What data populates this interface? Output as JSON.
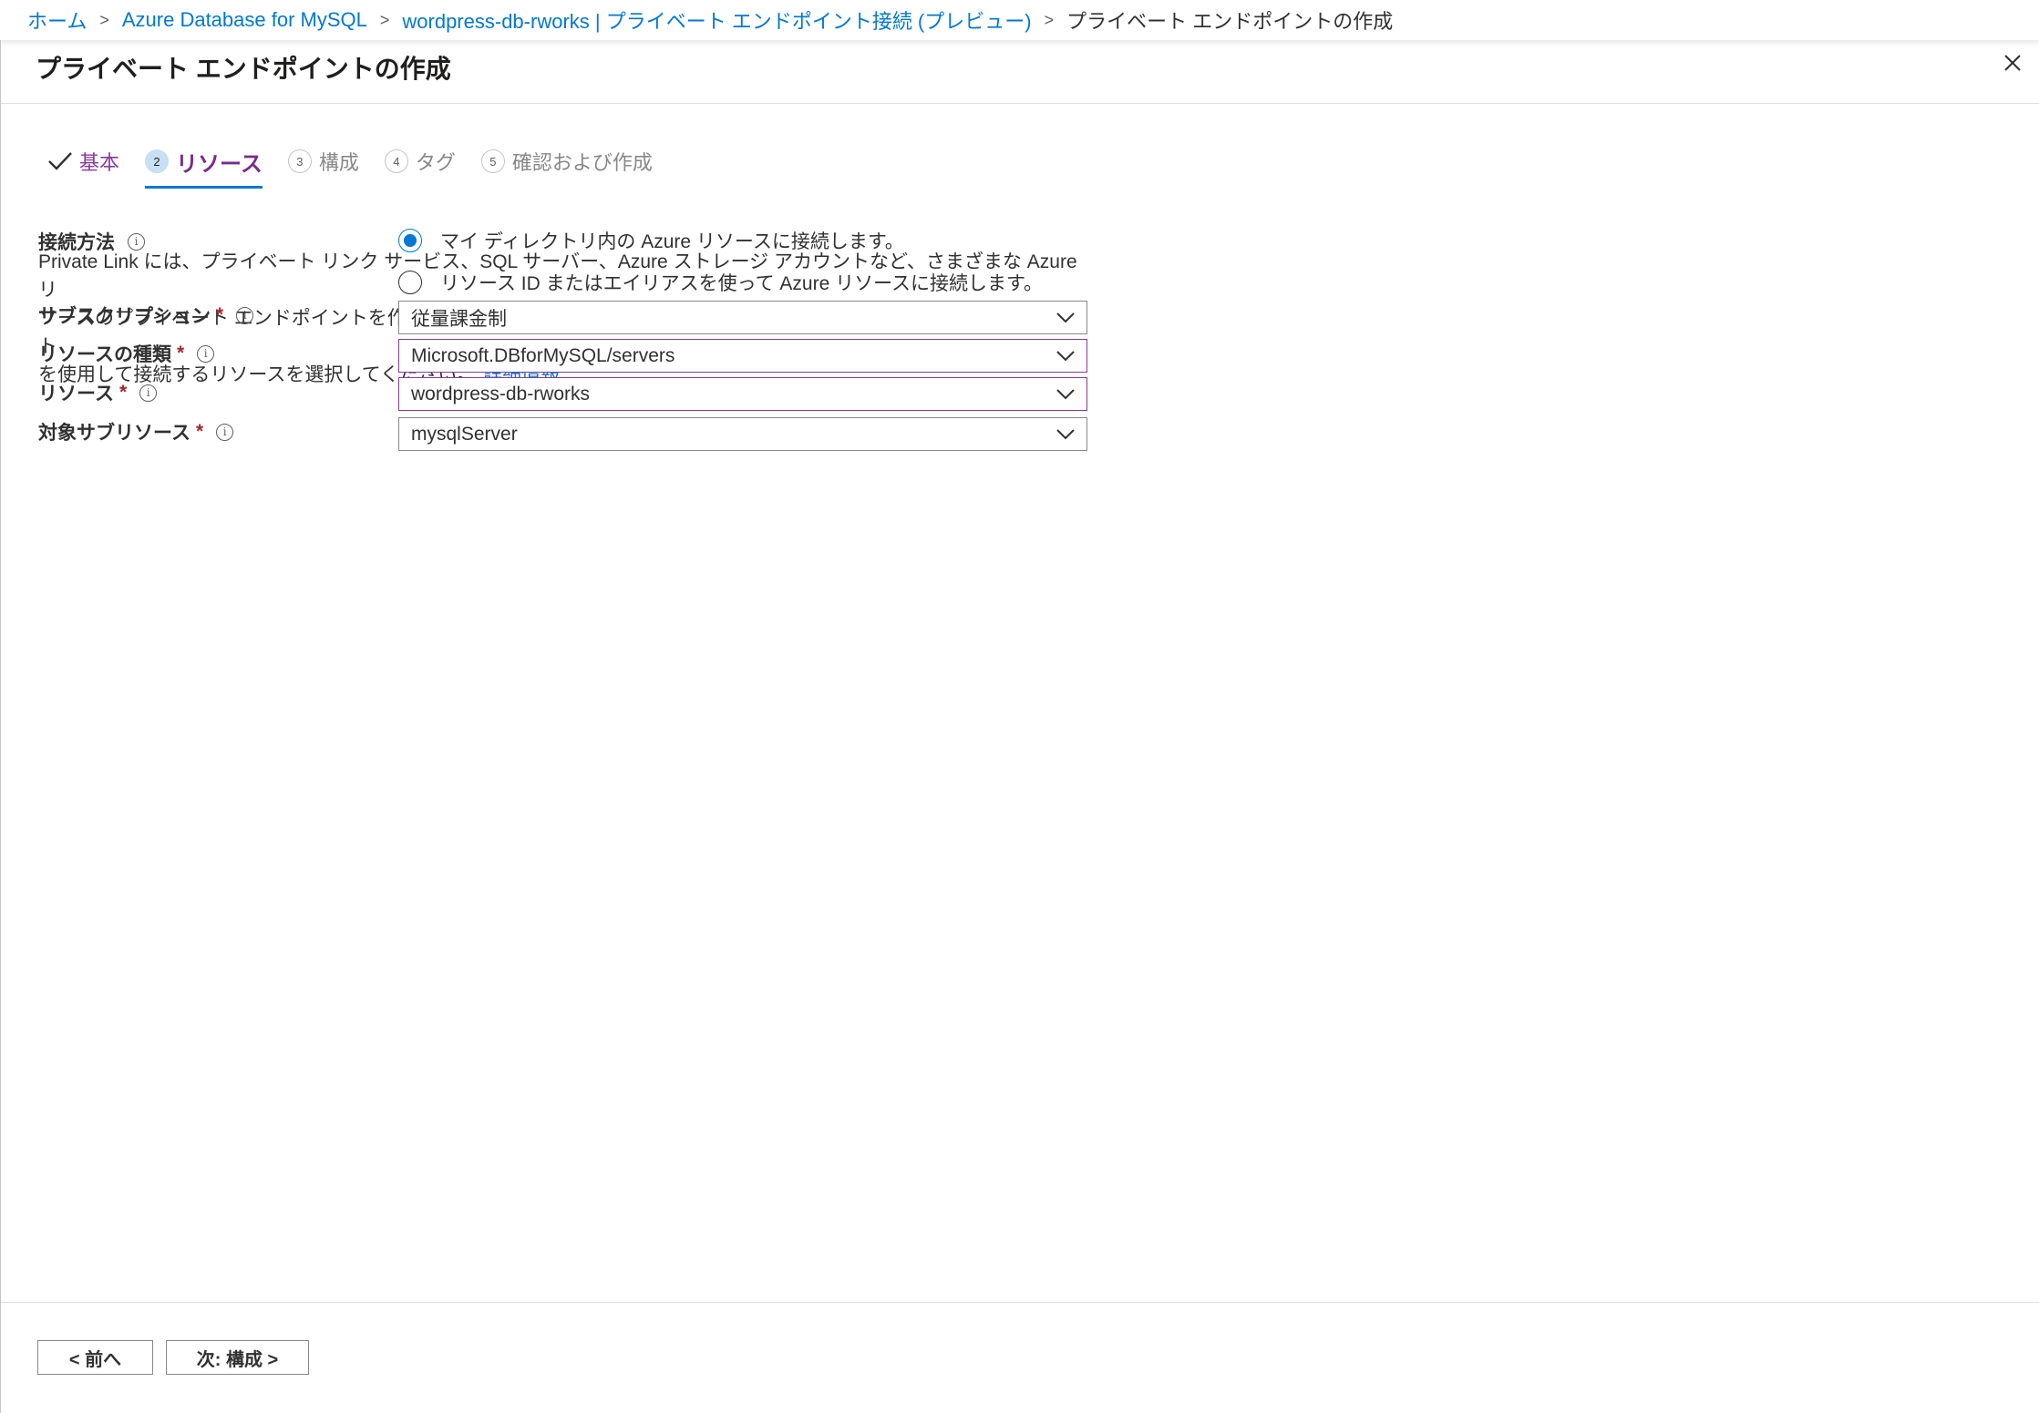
{
  "breadcrumb": {
    "items": [
      "ホーム",
      "Azure Database for MySQL",
      "wordpress-db-rworks | プライベート エンドポイント接続 (プレビュー)"
    ],
    "current": "プライベート エンドポイントの作成"
  },
  "page": {
    "title": "プライベート エンドポイントの作成"
  },
  "icons": {
    "close": "close-icon",
    "check": "checkmark-icon",
    "chevron": "chevron-down-icon",
    "info": "info-icon"
  },
  "tabs": [
    {
      "num": "",
      "label": "基本",
      "state": "done"
    },
    {
      "num": "2",
      "label": "リソース",
      "state": "active"
    },
    {
      "num": "3",
      "label": "構成",
      "state": "pending"
    },
    {
      "num": "4",
      "label": "タグ",
      "state": "pending"
    },
    {
      "num": "5",
      "label": "確認および作成",
      "state": "pending"
    }
  ],
  "description": {
    "line1": "Private Link には、プライベート リンク サービス、SQL サーバー、Azure ストレージ アカウントなど、さまざまな Azure リ",
    "line2": "ソースのプライベート エンドポイントを作成するためのオプションが用意されています。このプライベート エンドポイント",
    "line3": "を使用して接続するリソースを選択してください。",
    "learn_more": "詳細情報"
  },
  "form": {
    "connection_method": {
      "label": "接続方法",
      "info": "i",
      "options": [
        {
          "label": "マイ ディレクトリ内の Azure リソースに接続します。",
          "checked": true
        },
        {
          "label": "リソース ID またはエイリアスを使って Azure リソースに接続します。",
          "checked": false
        }
      ]
    },
    "subscription": {
      "label": "サブスクリプション",
      "required": "*",
      "info": "i",
      "value": "従量課金制"
    },
    "resource_type": {
      "label": "リソースの種類",
      "required": "*",
      "info": "i",
      "value": "Microsoft.DBforMySQL/servers"
    },
    "resource": {
      "label": "リソース",
      "required": "*",
      "info": "i",
      "value": "wordpress-db-rworks"
    },
    "target_subresource": {
      "label": "対象サブリソース",
      "required": "*",
      "info": "i",
      "value": "mysqlServer"
    }
  },
  "footer": {
    "prev_label": "< 前へ",
    "next_label": "次: 構成 >"
  },
  "colors": {
    "link": "#0078d4",
    "accent_purple": "#8a3a9e",
    "required": "#a4262c"
  }
}
